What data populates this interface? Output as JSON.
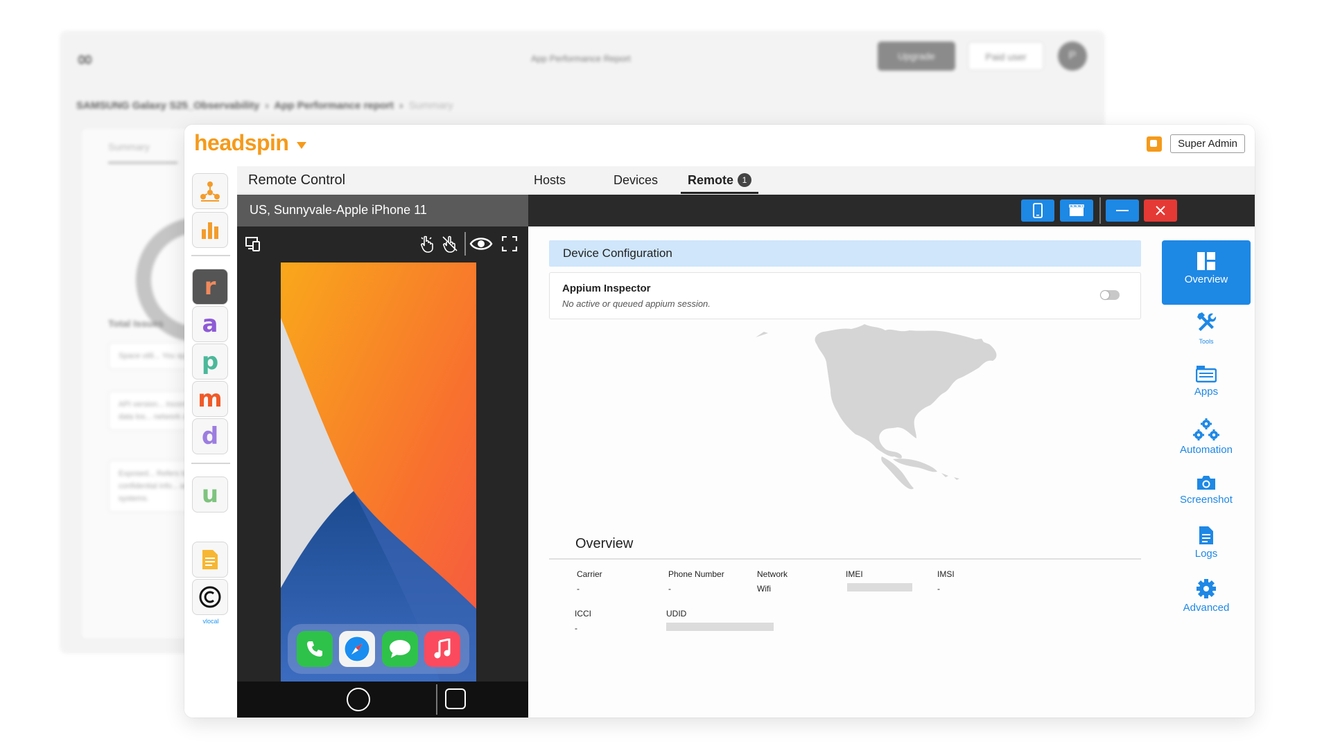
{
  "background_window": {
    "title": "App Performance Report",
    "upgrade_label": "Upgrade",
    "user_label": "Paid user",
    "avatar_initial": "P",
    "breadcrumb": [
      "SAMSUNG Galaxy S25_Observability",
      "App Performance report",
      "Summary"
    ],
    "tab_label": "Summary",
    "issues_label": "Total Issues",
    "cards": [
      "Space utili... You app took 10...",
      "API version... Incompatible cli... lead to data los... network comm...",
      "Exposed... Refers to the ut... confidential info... accessible to u... systems."
    ]
  },
  "brand": {
    "name": "headspin",
    "caret_color": "#f59a1b"
  },
  "header": {
    "role_button": "Super Admin"
  },
  "left_rail": {
    "items": [
      {
        "name": "network-hub-icon"
      },
      {
        "name": "bar-chart-icon"
      },
      {
        "name": "r-app-icon",
        "letter": "r"
      },
      {
        "name": "a-app-icon",
        "letter": "a"
      },
      {
        "name": "p-app-icon",
        "letter": "p"
      },
      {
        "name": "m-app-icon",
        "letter": "m"
      },
      {
        "name": "d-app-icon",
        "letter": "d"
      },
      {
        "name": "u-app-icon",
        "letter": "u"
      },
      {
        "name": "document-icon"
      },
      {
        "name": "copyright-icon"
      }
    ],
    "caption": "vlocal"
  },
  "tabs_bar": {
    "page_title": "Remote Control",
    "tabs": [
      {
        "label": "Hosts",
        "active": false
      },
      {
        "label": "Devices",
        "active": false
      },
      {
        "label": "Remote",
        "active": true,
        "badge": "1"
      }
    ]
  },
  "device": {
    "title": "US, Sunnyvale-Apple iPhone 11",
    "header_buttons": [
      "phone-icon",
      "video-icon",
      "minimize-icon",
      "close-icon"
    ],
    "tools": [
      "device-list-icon",
      "tap-gesture-icon",
      "swipe-gesture-icon",
      "eye-icon",
      "fullscreen-icon"
    ],
    "dock_apps": [
      "phone-app-icon",
      "safari-app-icon",
      "messages-app-icon",
      "music-app-icon"
    ]
  },
  "device_config": {
    "section_label": "Device Configuration",
    "appium_title": "Appium Inspector",
    "appium_status": "No active or queued appium session."
  },
  "overview": {
    "title": "Overview",
    "fields": [
      {
        "label": "Carrier",
        "value": "-"
      },
      {
        "label": "Phone Number",
        "value": "-"
      },
      {
        "label": "Network",
        "value": "Wifi"
      },
      {
        "label": "IMEI",
        "value": "",
        "redacted": true
      },
      {
        "label": "IMSI",
        "value": "-"
      },
      {
        "label": "ICCI",
        "value": "-"
      },
      {
        "label": "UDID",
        "value": "",
        "redacted": true
      }
    ]
  },
  "actions": [
    {
      "label": "Overview",
      "icon": "overview-icon",
      "active": true
    },
    {
      "label": "Tools",
      "icon": "tools-icon",
      "active": false
    },
    {
      "label": "Apps",
      "icon": "apps-icon",
      "active": false
    },
    {
      "label": "Automation",
      "icon": "automation-icon",
      "active": false
    },
    {
      "label": "Screenshot",
      "icon": "camera-icon",
      "active": false
    },
    {
      "label": "Logs",
      "icon": "logs-icon",
      "active": false
    },
    {
      "label": "Advanced",
      "icon": "gear-icon",
      "active": false
    }
  ],
  "colors": {
    "accent": "#1e88e5",
    "brand": "#f59a1b",
    "close": "#e53935",
    "config_bg": "#cfe6fb"
  }
}
